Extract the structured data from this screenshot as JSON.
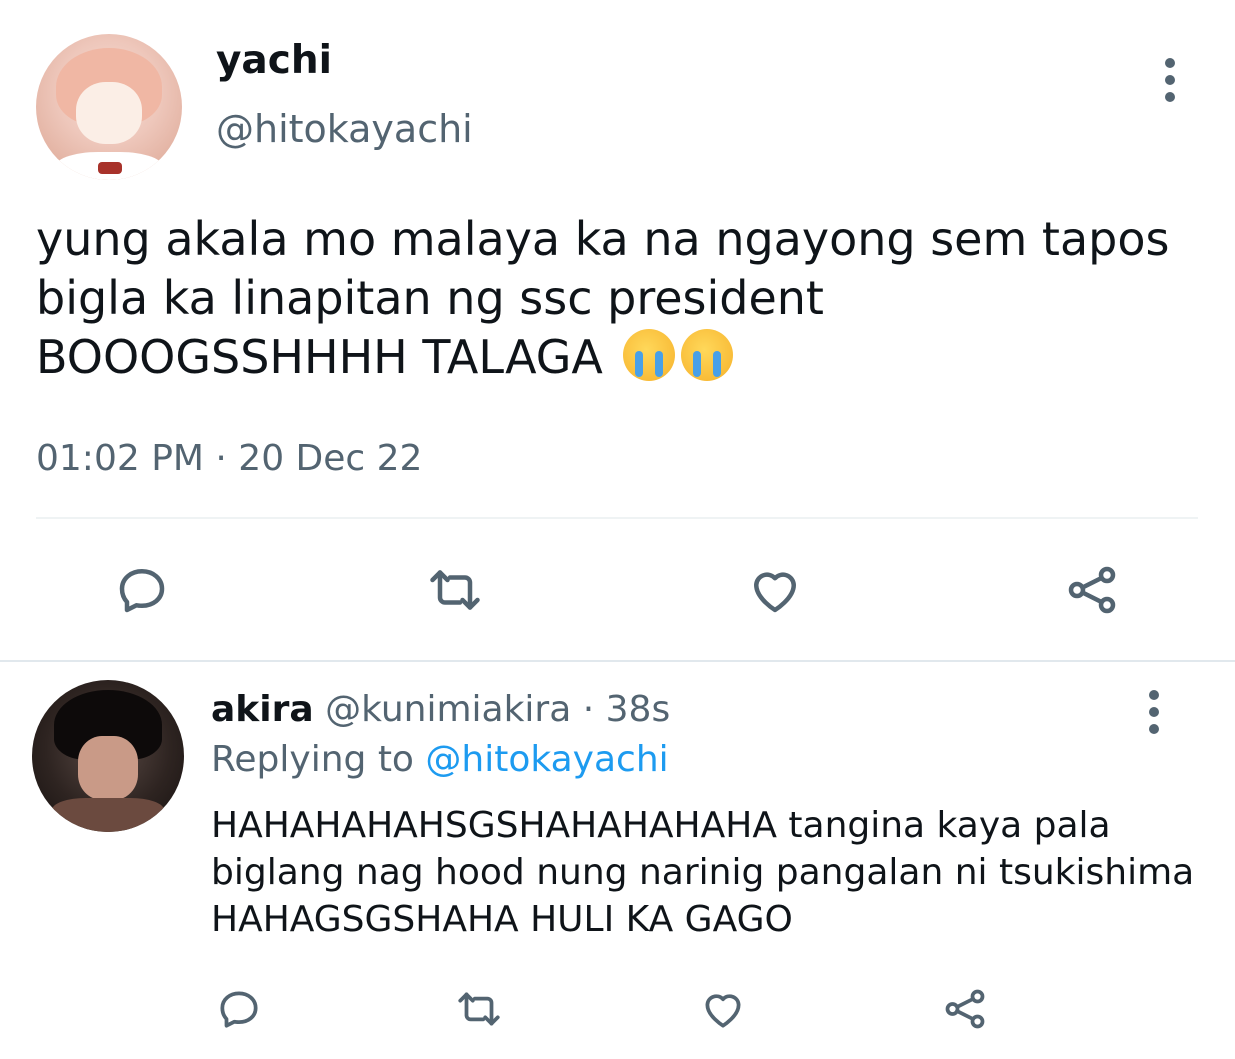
{
  "main_tweet": {
    "name": "yachi",
    "handle": "@hitokayachi",
    "text": "yung akala mo malaya ka na ngayong sem tapos bigla ka linapitan ng ssc president BOOOGSSHHHH TALAGA",
    "emojis": [
      "loudly-crying-face",
      "loudly-crying-face"
    ],
    "timestamp": "01:02 PM · 20 Dec 22",
    "actions": [
      "reply-icon",
      "retweet-icon",
      "like-icon",
      "share-icon"
    ]
  },
  "reply_tweet": {
    "name": "akira",
    "handle": "@kunimiakira",
    "age": "· 38s",
    "replying_to_label": "Replying to",
    "replying_to_handle": "@hitokayachi",
    "text": "HAHAHAHAHSGSHAHAHAHAHA tangina kaya pala biglang nag hood nung narinig pangalan ni tsukishima HAHAGSGSHAHA HULI KA GAGO",
    "actions": [
      "reply-icon",
      "retweet-icon",
      "like-icon",
      "share-icon"
    ]
  },
  "colors": {
    "text": "#0f1419",
    "secondary": "#536471",
    "link": "#1d9bf0",
    "divider": "#eff3f4"
  }
}
